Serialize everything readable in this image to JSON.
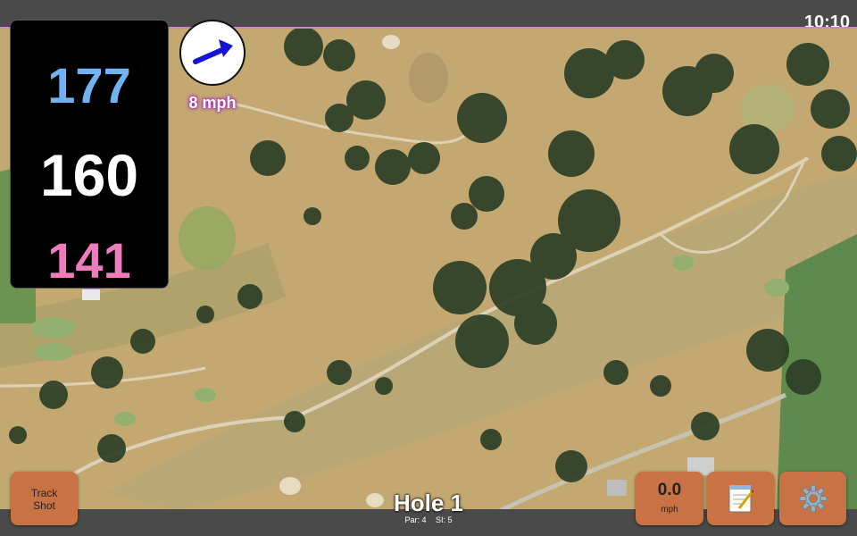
{
  "status_bar": {
    "time": "10:10"
  },
  "distances": {
    "back": "177",
    "center": "160",
    "front": "141"
  },
  "wind": {
    "speed_label": "8 mph",
    "direction_icon": "arrow-up-right-icon"
  },
  "hole": {
    "title": "Hole 1",
    "par": "Par: 4",
    "si": "SI: 5"
  },
  "buttons": {
    "track_shot_line1": "Track",
    "track_shot_line2": "Shot",
    "speed_value": "0.0",
    "speed_unit": "mph",
    "notes_icon": "notepad-icon",
    "settings_icon": "gear-icon"
  },
  "colors": {
    "back_distance": "#6fb3f2",
    "center_distance": "#ffffff",
    "front_distance": "#f27bbd",
    "button": "#c97345",
    "wind_glow": "#b02fb0"
  }
}
